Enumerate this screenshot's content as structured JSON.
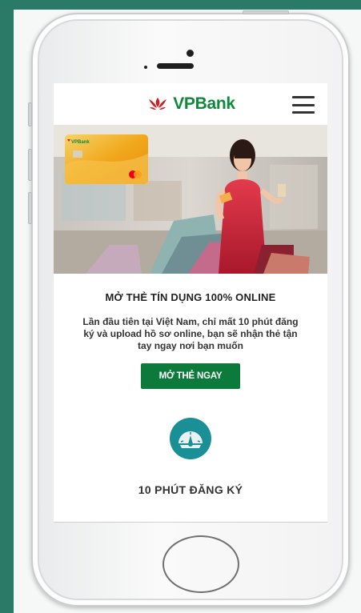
{
  "brand": {
    "name": "VPBank",
    "color": "#0f8a3c",
    "logo_color": "#d71920"
  },
  "header": {
    "menu_icon": "hamburger-menu-icon"
  },
  "hero": {
    "card_brand": "VPBank"
  },
  "main": {
    "headline": "MỞ THẺ TÍN DỤNG 100% ONLINE",
    "description": "Lần đầu tiên tại Việt Nam, chỉ mất 10 phút đăng ký và upload hồ sơ online, bạn sẽ nhận thẻ tận tay ngay nơi bạn muốn",
    "cta_label": "MỞ THẺ NGAY",
    "cta_color": "#0c7a3a"
  },
  "feature": {
    "icon": "speedometer-icon",
    "title": "10 PHÚT ĐĂNG KÝ",
    "icon_color": "#1a8f95"
  }
}
